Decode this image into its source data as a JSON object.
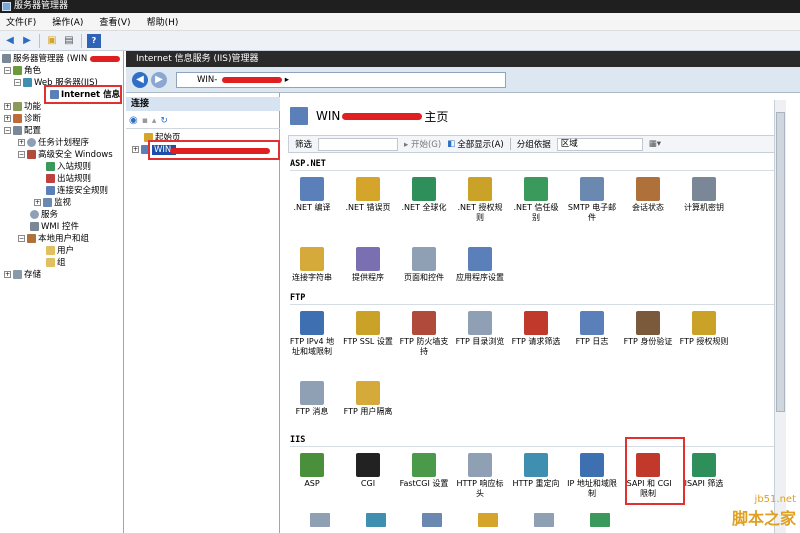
{
  "window": {
    "title": "服务器管理器"
  },
  "menu": [
    "文件(F)",
    "操作(A)",
    "查看(V)",
    "帮助(H)"
  ],
  "left_tree": [
    {
      "label": "服务器管理器 (WIN",
      "indent": 0
    },
    {
      "label": "角色",
      "indent": 1
    },
    {
      "label": "Web 服务器(IIS)",
      "indent": 2
    },
    {
      "label": "Internet 信息",
      "indent": 3
    },
    {
      "label": "功能",
      "indent": 1
    },
    {
      "label": "诊断",
      "indent": 1
    },
    {
      "label": "配置",
      "indent": 1
    },
    {
      "label": "任务计划程序",
      "indent": 2
    },
    {
      "label": "高级安全 Windows",
      "indent": 2
    },
    {
      "label": "入站规则",
      "indent": 3
    },
    {
      "label": "出站规则",
      "indent": 3
    },
    {
      "label": "连接安全规则",
      "indent": 3
    },
    {
      "label": "监视",
      "indent": 3
    },
    {
      "label": "服务",
      "indent": 2
    },
    {
      "label": "WMI 控件",
      "indent": 2
    },
    {
      "label": "本地用户和组",
      "indent": 2
    },
    {
      "label": "用户",
      "indent": 3
    },
    {
      "label": "组",
      "indent": 3
    },
    {
      "label": "存储",
      "indent": 0
    }
  ],
  "iis": {
    "header": "Internet 信息服务 (IIS)管理器",
    "address": "WIN-",
    "connections_title": "连接",
    "conn_tree": [
      "起始页",
      "WIN-"
    ],
    "page_title_prefix": "WIN",
    "page_title_suffix": "主页",
    "filter": {
      "label": "筛选",
      "start": "开始(G)",
      "show_all": "全部显示(A)",
      "group_by": "分组依据",
      "group_value": "区域"
    }
  },
  "groups": [
    {
      "name": "ASP.NET",
      "items": [
        {
          "label": ".NET 编译",
          "icon": "net-compile-icon",
          "color": "#5b7fb8"
        },
        {
          "label": ".NET 错误页",
          "icon": "net-error-page-icon",
          "color": "#d4a52a"
        },
        {
          "label": ".NET 全球化",
          "icon": "globe-icon",
          "color": "#2f8f5a"
        },
        {
          "label": ".NET 授权规则",
          "icon": "lock-icon",
          "color": "#c9a227"
        },
        {
          "label": ".NET 信任级别",
          "icon": "trust-icon",
          "color": "#3a9a5b"
        },
        {
          "label": "SMTP 电子邮件",
          "icon": "mail-icon",
          "color": "#6a88b0"
        },
        {
          "label": "会话状态",
          "icon": "session-icon",
          "color": "#b0703a"
        },
        {
          "label": "计算机密钥",
          "icon": "machine-key-icon",
          "color": "#7a8796"
        },
        {
          "label": "连接字符串",
          "icon": "db-icon",
          "color": "#d6aa3a"
        },
        {
          "label": "提供程序",
          "icon": "provider-icon",
          "color": "#7a6fb0"
        },
        {
          "label": "页面和控件",
          "icon": "page-icon",
          "color": "#8fa0b4"
        },
        {
          "label": "应用程序设置",
          "icon": "settings-icon",
          "color": "#5b7fb8"
        }
      ]
    },
    {
      "name": "FTP",
      "items": [
        {
          "label": "FTP IPv4 地址和域限制",
          "icon": "ftp-ip-icon",
          "color": "#3e6fb0"
        },
        {
          "label": "FTP SSL 设置",
          "icon": "ftp-ssl-icon",
          "color": "#c9a227"
        },
        {
          "label": "FTP 防火墙支持",
          "icon": "ftp-firewall-icon",
          "color": "#b04a3a"
        },
        {
          "label": "FTP 目录浏览",
          "icon": "ftp-dir-icon",
          "color": "#8fa0b4"
        },
        {
          "label": "FTP 请求筛选",
          "icon": "ftp-filter-icon",
          "color": "#c0392b"
        },
        {
          "label": "FTP 日志",
          "icon": "ftp-log-icon",
          "color": "#5b7fb8"
        },
        {
          "label": "FTP 身份验证",
          "icon": "ftp-auth-icon",
          "color": "#7a5a3a"
        },
        {
          "label": "FTP 授权规则",
          "icon": "ftp-authz-icon",
          "color": "#c9a227"
        },
        {
          "label": "FTP 消息",
          "icon": "ftp-message-icon",
          "color": "#8fa0b4"
        },
        {
          "label": "FTP 用户隔离",
          "icon": "ftp-user-icon",
          "color": "#d6aa3a"
        }
      ]
    },
    {
      "name": "IIS",
      "items": [
        {
          "label": "ASP",
          "icon": "asp-icon",
          "color": "#4a8f3a"
        },
        {
          "label": "CGI",
          "icon": "cgi-icon",
          "color": "#222222"
        },
        {
          "label": "FastCGI 设置",
          "icon": "fastcgi-icon",
          "color": "#4a9a4a"
        },
        {
          "label": "HTTP 响应标头",
          "icon": "http-header-icon",
          "color": "#8fa0b4"
        },
        {
          "label": "HTTP 重定向",
          "icon": "redirect-icon",
          "color": "#3e8fb0"
        },
        {
          "label": "IP 地址和域限制",
          "icon": "ip-restrict-icon",
          "color": "#3e6fb0"
        },
        {
          "label": "ISAPI 和 CGI 限制",
          "icon": "isapi-cgi-icon",
          "color": "#c0392b"
        },
        {
          "label": "ISAPI 筛选",
          "icon": "isapi-filter-icon",
          "color": "#2f8f5a"
        }
      ]
    }
  ],
  "watermark": {
    "site": "jb51.net",
    "name": "脚本之家"
  }
}
